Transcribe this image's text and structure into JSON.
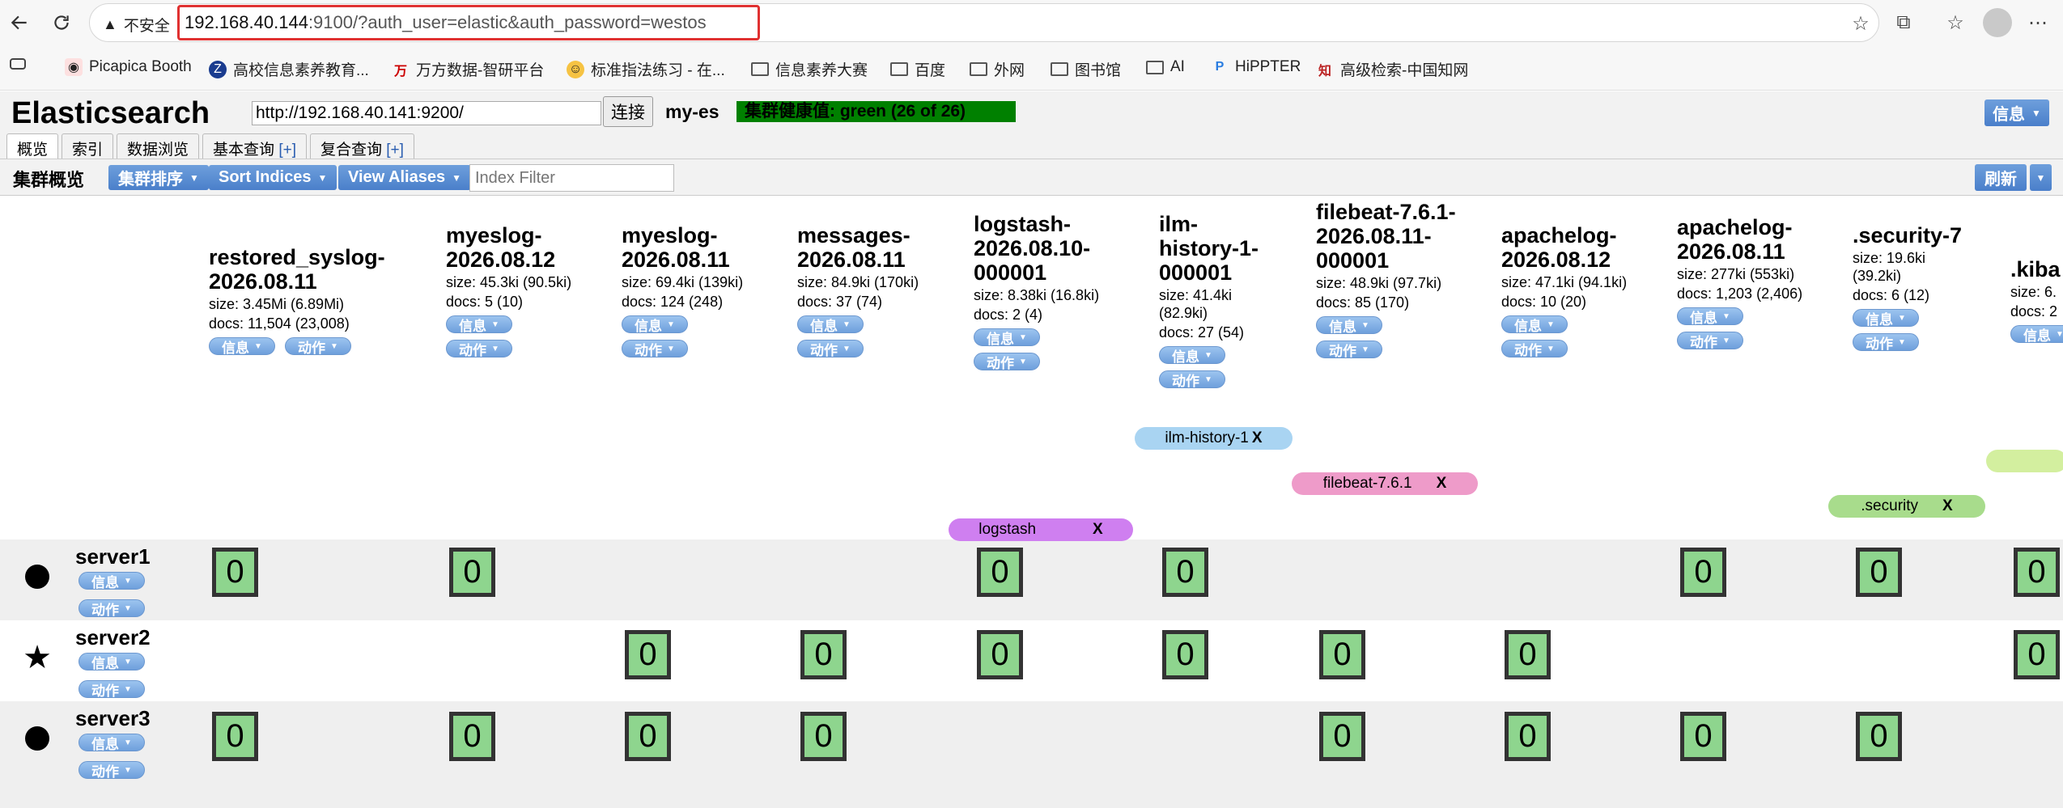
{
  "browser": {
    "insecure_label": "不安全",
    "url_host": "192.168.40.144",
    "url_rest": ":9100/?auth_user=elastic&auth_password=westos",
    "bookmarks": [
      "Picapica Booth",
      "高校信息素养教育...",
      "万方数据-智研平台",
      "标准指法练习 - 在...",
      "信息素养大赛",
      "百度",
      "外网",
      "图书馆",
      "AI",
      "HiPPTER",
      "高级检索-中国知网"
    ]
  },
  "app": {
    "title": "Elasticsearch",
    "connect_url": "http://192.168.40.141:9200/",
    "connect_label": "连接",
    "cluster_name": "my-es",
    "health": "集群健康值: green (26 of 26)",
    "health_color": "#008000",
    "info_label": "信息",
    "tabs": [
      {
        "label": "概览",
        "plus": ""
      },
      {
        "label": "索引",
        "plus": ""
      },
      {
        "label": "数据浏览",
        "plus": ""
      },
      {
        "label": "基本查询 ",
        "plus": "[+]"
      },
      {
        "label": "复合查询 ",
        "plus": "[+]"
      }
    ]
  },
  "toolbar": {
    "title": "集群概览",
    "sort_cluster": "集群排序",
    "sort_indices": "Sort Indices",
    "view_aliases": "View Aliases",
    "index_filter_placeholder": "Index Filter",
    "refresh": "刷新"
  },
  "pill_labels": {
    "info": "信息",
    "action": "动作"
  },
  "indices": [
    {
      "name": "restored_syslog-2026.08.11",
      "size": "size: 3.45Mi (6.89Mi)",
      "docs": "docs: 11,504 (23,008)"
    },
    {
      "name": "myeslog-2026.08.12",
      "size": "size: 45.3ki (90.5ki)",
      "docs": "docs: 5 (10)"
    },
    {
      "name": "myeslog-2026.08.11",
      "size": "size: 69.4ki (139ki)",
      "docs": "docs: 124 (248)"
    },
    {
      "name": "messages-2026.08.11",
      "size": "size: 84.9ki (170ki)",
      "docs": "docs: 37 (74)"
    },
    {
      "name": "logstash-2026.08.10-000001",
      "size": "size: 8.38ki (16.8ki)",
      "docs": "docs: 2 (4)"
    },
    {
      "name": "ilm-history-1-000001",
      "size": "size: 41.4ki (82.9ki)",
      "docs": "docs: 27 (54)"
    },
    {
      "name": "filebeat-7.6.1-2026.08.11-000001",
      "size": "size: 48.9ki (97.7ki)",
      "docs": "docs: 85 (170)"
    },
    {
      "name": "apachelog-2026.08.12",
      "size": "size: 47.1ki (94.1ki)",
      "docs": "docs: 10 (20)"
    },
    {
      "name": "apachelog-2026.08.11",
      "size": "size: 277ki (553ki)",
      "docs": "docs: 1,203 (2,406)"
    },
    {
      "name": ".security-7",
      "size": "size: 19.6ki (39.2ki)",
      "docs": "docs: 6 (12)"
    },
    {
      "name": ".kiba",
      "size": "size: 6.",
      "docs": "docs: 2"
    }
  ],
  "aliases": [
    {
      "name": "ilm-history-1",
      "x": "X",
      "color": "#a9d4f2"
    },
    {
      "name": "filebeat-7.6.1",
      "x": "X",
      "color": "#ee9bc9"
    },
    {
      "name": "logstash",
      "x": "X",
      "color": "#cf7ff0"
    },
    {
      "name": ".security",
      "x": "X",
      "color": "#a8dc8c"
    }
  ],
  "servers": [
    {
      "name": "server1",
      "icon": "circle-icon"
    },
    {
      "name": "server2",
      "icon": "star-icon"
    },
    {
      "name": "server3",
      "icon": "circle-icon"
    }
  ],
  "shard_label": "0"
}
